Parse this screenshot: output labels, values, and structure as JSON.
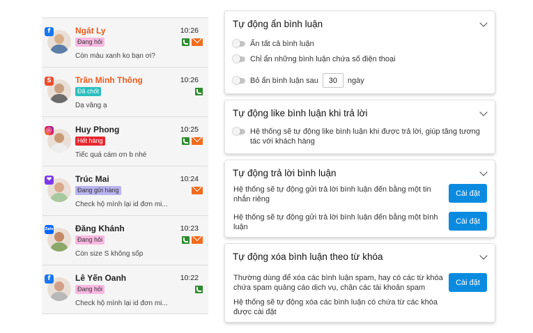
{
  "conversations": [
    {
      "name": "Ngát Ly",
      "time": "10:26",
      "badge": "Đang hỏi",
      "badge_bg": "#f9b9e2",
      "badge_fg": "#333333",
      "preview": "Còn màu xanh ko bạn ơi?",
      "platform_icon": "facebook-icon",
      "unread": true,
      "icons": [
        "phone",
        "mail"
      ]
    },
    {
      "name": "Trần Minh Thông",
      "time": "10:26",
      "badge": "Đã chốt",
      "badge_bg": "#2bbfbf",
      "badge_fg": "#ffffff",
      "preview": "Dạ vâng ạ",
      "platform_icon": "shopee-icon",
      "unread": true,
      "icons": [
        "phone"
      ]
    },
    {
      "name": "Huy Phong",
      "time": "10:25",
      "badge": "Hết hàng",
      "badge_bg": "#e8262e",
      "badge_fg": "#ffffff",
      "preview": "Tiếc quá cám ơn b nhé",
      "platform_icon": "instagram-icon",
      "unread": false,
      "icons": [
        "phone",
        "mail"
      ]
    },
    {
      "name": "Trúc Mai",
      "time": "10:24",
      "badge": "Đang gửi hàng",
      "badge_bg": "#b9b3f0",
      "badge_fg": "#333333",
      "preview": "Check hộ mình lại id đơn mi...",
      "platform_icon": "chat-app-icon",
      "unread": false,
      "icons": [
        "mail"
      ]
    },
    {
      "name": "Đăng Khánh",
      "time": "10:23",
      "badge": "Đang hỏi",
      "badge_bg": "#f9b9e2",
      "badge_fg": "#333333",
      "preview": "Còn size S không sốp",
      "platform_icon": "zalo-icon",
      "unread": false,
      "icons": [
        "phone",
        "mail"
      ]
    },
    {
      "name": "Lê Yến Oanh",
      "time": "10:22",
      "badge": "Đang hỏi",
      "badge_bg": "#f9b9e2",
      "badge_fg": "#333333",
      "preview": "Check hộ mình lại id đơn mi...",
      "platform_icon": "facebook-icon",
      "unread": false,
      "icons": [
        "phone"
      ]
    }
  ],
  "cards": {
    "hide": {
      "title": "Tự động ẩn bình luận",
      "opt_all": "Ẩn tất cả bình luận",
      "opt_phone": "Chỉ ẩn những bình luận chứa số điện thoại",
      "opt_after_prefix": "Bỏ ẩn bình luận sau",
      "opt_after_value": "30",
      "opt_after_suffix": "ngày"
    },
    "like": {
      "title": "Tự động like bình luận khi trả lời",
      "opt_line1": "Hệ thống sẽ tự động like bình luận khi được trả lời, giúp tăng tương",
      "opt_line2": "tác với khách hàng"
    },
    "reply": {
      "title": "Tự động trả lời bình luận",
      "desc1_line1": "Hệ thống sẽ tự động gửi trả lời bình luận đến bằng một tin",
      "desc1_line2": "nhắn riêng",
      "desc2_line1": "Hệ thống sẽ tự động gửi trả lời bình luận đến bằng một bình",
      "desc2_line2": "luận",
      "button": "Cài đặt"
    },
    "delete": {
      "title": "Tự động xóa bình luận theo từ khóa",
      "desc1_line1": "Thường dùng để xóa các bình luận spam, hay có các từ khóa",
      "desc1_line2": "chứa spam quảng cáo dịch vụ, chặn các tài khoản spam",
      "desc2_line1": "Hệ thống sẽ tự động xóa các bình luận có chứa từ các khóa",
      "desc2_line2": "được cài đặt",
      "button": "Cài đặt"
    }
  },
  "colors": {
    "accent": "#0b8be0",
    "unread_name": "#ef5a1a",
    "phone": "#2e8b2e",
    "mail": "#f26b1d"
  }
}
